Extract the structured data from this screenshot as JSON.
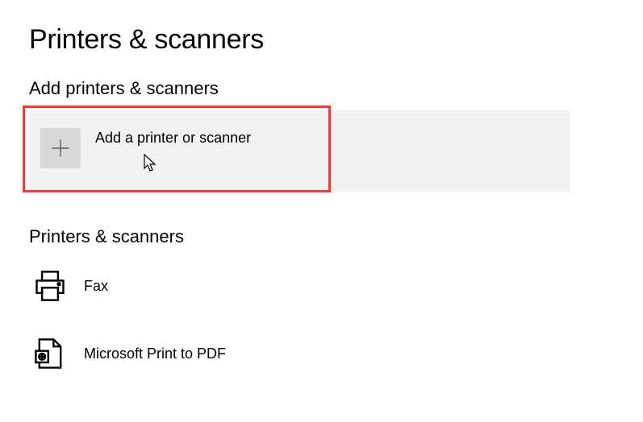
{
  "page": {
    "title": "Printers & scanners"
  },
  "addSection": {
    "title": "Add printers & scanners",
    "button_label": "Add a printer or scanner"
  },
  "listSection": {
    "title": "Printers & scanners",
    "items": [
      {
        "label": "Fax"
      },
      {
        "label": "Microsoft Print to PDF"
      }
    ]
  }
}
